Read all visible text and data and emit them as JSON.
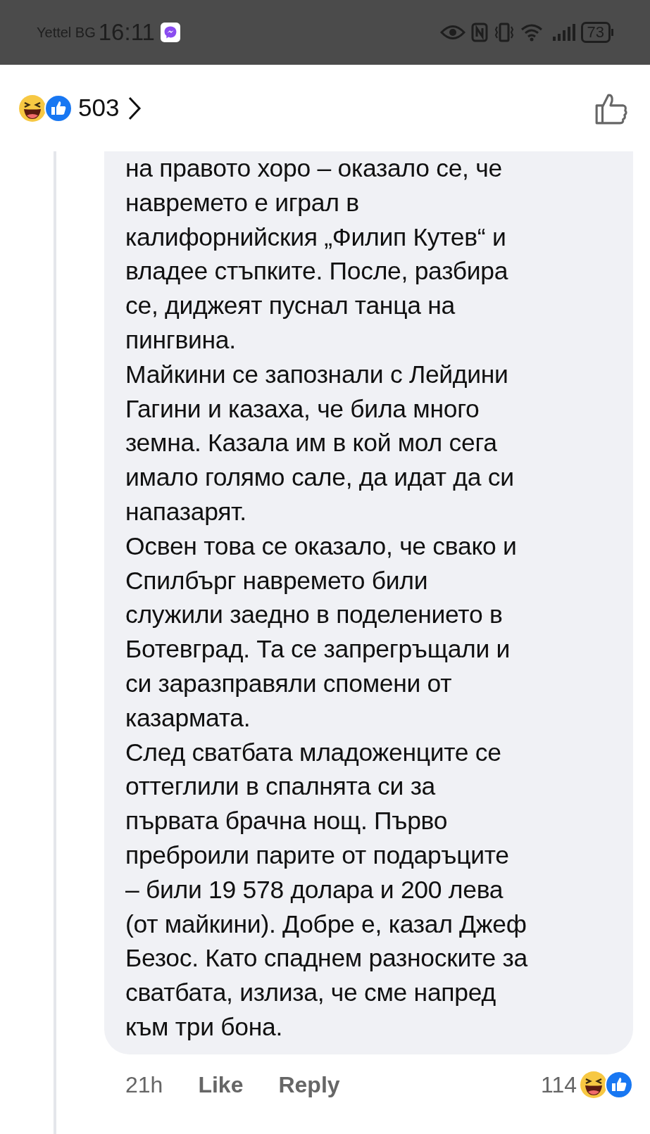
{
  "status_bar": {
    "carrier": "Yettel BG",
    "time": "16:11",
    "battery": "73"
  },
  "header": {
    "reaction_count": "503"
  },
  "comment": {
    "lines": [
      "на правото хоро – оказало се, че",
      "навремето е играл в",
      "калифорнийския „Филип Кутев“ и",
      "владее стъпките. После, разбира",
      "се, диджеят пуснал танца на",
      "пингвина.",
      "Майкини се запознали с Лейдини",
      "Гагини и казаха, че била много",
      "земна. Казала им в кой мол сега",
      "имало голямо сале, да идат да си",
      "напазарят.",
      "Освен това се оказало, че свако и",
      "Спилбърг навремето били",
      "служили заедно в поделението в",
      "Ботевград. Та се запрегръщали и",
      "си заразправяли спомени от",
      "казармата.",
      "След сватбата младоженците се",
      "оттеглили в спалнята си за",
      "първата брачна нощ. Първо",
      "преброили парите от подаръците",
      "– били 19 578 долара и 200 лева",
      "(от майкини). Добре е, казал Джеф",
      "Безос. Като спаднем разноските за",
      "сватбата, излиза, че сме напред",
      "към три бона."
    ],
    "time": "21h",
    "like": "Like",
    "reply": "Reply",
    "reaction_count": "114"
  }
}
